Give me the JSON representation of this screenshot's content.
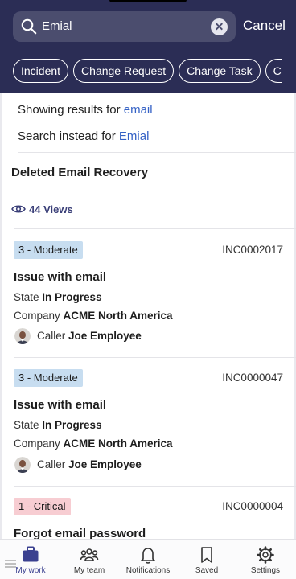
{
  "search": {
    "value": "Emial",
    "cancel_label": "Cancel"
  },
  "chips": [
    "Incident",
    "Change Request",
    "Change Task",
    "C"
  ],
  "suggestion": {
    "showing_prefix": "Showing results for ",
    "showing_term": "email",
    "instead_prefix": "Search instead for ",
    "instead_term": "Emial"
  },
  "kb": {
    "title": "Deleted Email Recovery",
    "views": "44 Views"
  },
  "incidents": [
    {
      "priority": "3 - Moderate",
      "number": "INC0002017",
      "title": "Issue with email",
      "state_label": "State",
      "state": "In Progress",
      "company_label": "Company",
      "company": "ACME North America",
      "caller_label": "Caller",
      "caller": "Joe Employee"
    },
    {
      "priority": "3 - Moderate",
      "number": "INC0000047",
      "title": "Issue with email",
      "state_label": "State",
      "state": "In Progress",
      "company_label": "Company",
      "company": "ACME North America",
      "caller_label": "Caller",
      "caller": "Joe Employee"
    },
    {
      "priority": "1 - Critical",
      "number": "INC0000004",
      "title": "Forgot email password"
    }
  ],
  "tabs": [
    {
      "label": "My work",
      "icon": "briefcase-icon",
      "active": true
    },
    {
      "label": "My team",
      "icon": "team-icon"
    },
    {
      "label": "Notifications",
      "icon": "bell-icon"
    },
    {
      "label": "Saved",
      "icon": "bookmark-icon"
    },
    {
      "label": "Settings",
      "icon": "gear-icon"
    }
  ],
  "colors": {
    "header": "#2b2d55",
    "accent": "#3b4190",
    "link": "#3461c5",
    "moderate": "#c7ddf0",
    "critical": "#f7cdd2"
  }
}
